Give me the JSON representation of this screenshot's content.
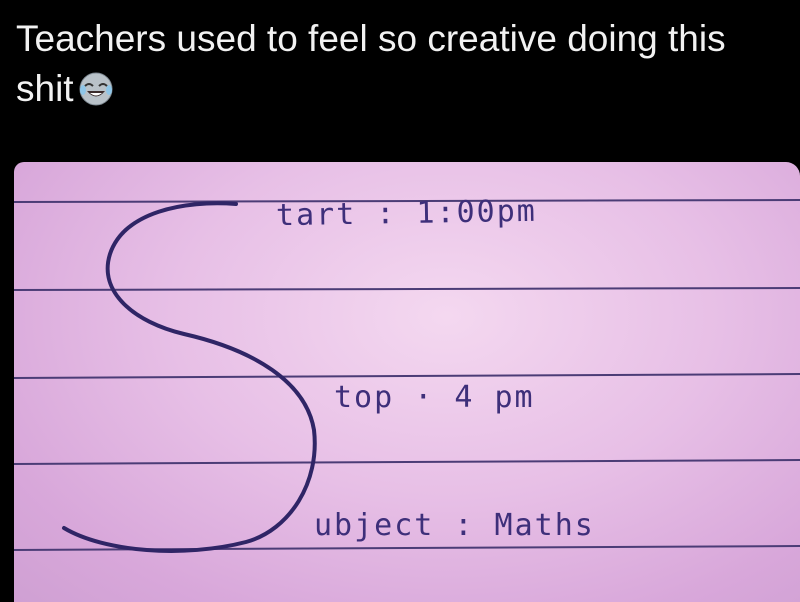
{
  "post": {
    "caption": "Teachers used to feel so creative doing this shit",
    "emoji": "face-with-tears-of-joy-icon"
  },
  "note": {
    "start_line": "tart : 1:00pm",
    "stop_line": "top · 4 pm",
    "subject_line": "ubject : Maths"
  }
}
